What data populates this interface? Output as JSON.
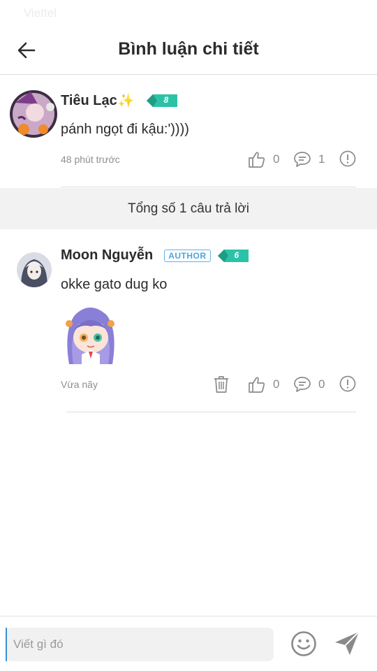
{
  "status_bar": {
    "carrier": "Viettel"
  },
  "header": {
    "title": "Bình luận chi tiết"
  },
  "parent_comment": {
    "author": "Tiêu Lạc",
    "sparkle": "✨",
    "level": "8",
    "content": "pánh ngọt đi kậu:'))))",
    "time": "48 phút trước",
    "likes": "0",
    "replies": "1"
  },
  "replies_summary": {
    "text": "Tổng số 1 câu trả lời"
  },
  "reply": {
    "author": "Moon Nguyễn",
    "badge": "AUTHOR",
    "level": "6",
    "content": "okke gato dug ko",
    "time": "Vừa nãy",
    "likes": "0",
    "replies": "0"
  },
  "composer": {
    "placeholder": "Viết gì đó"
  },
  "colors": {
    "accent": "#3b8fd6",
    "level_badge": "#2bc3a8",
    "author_badge": "#4aa5de"
  }
}
